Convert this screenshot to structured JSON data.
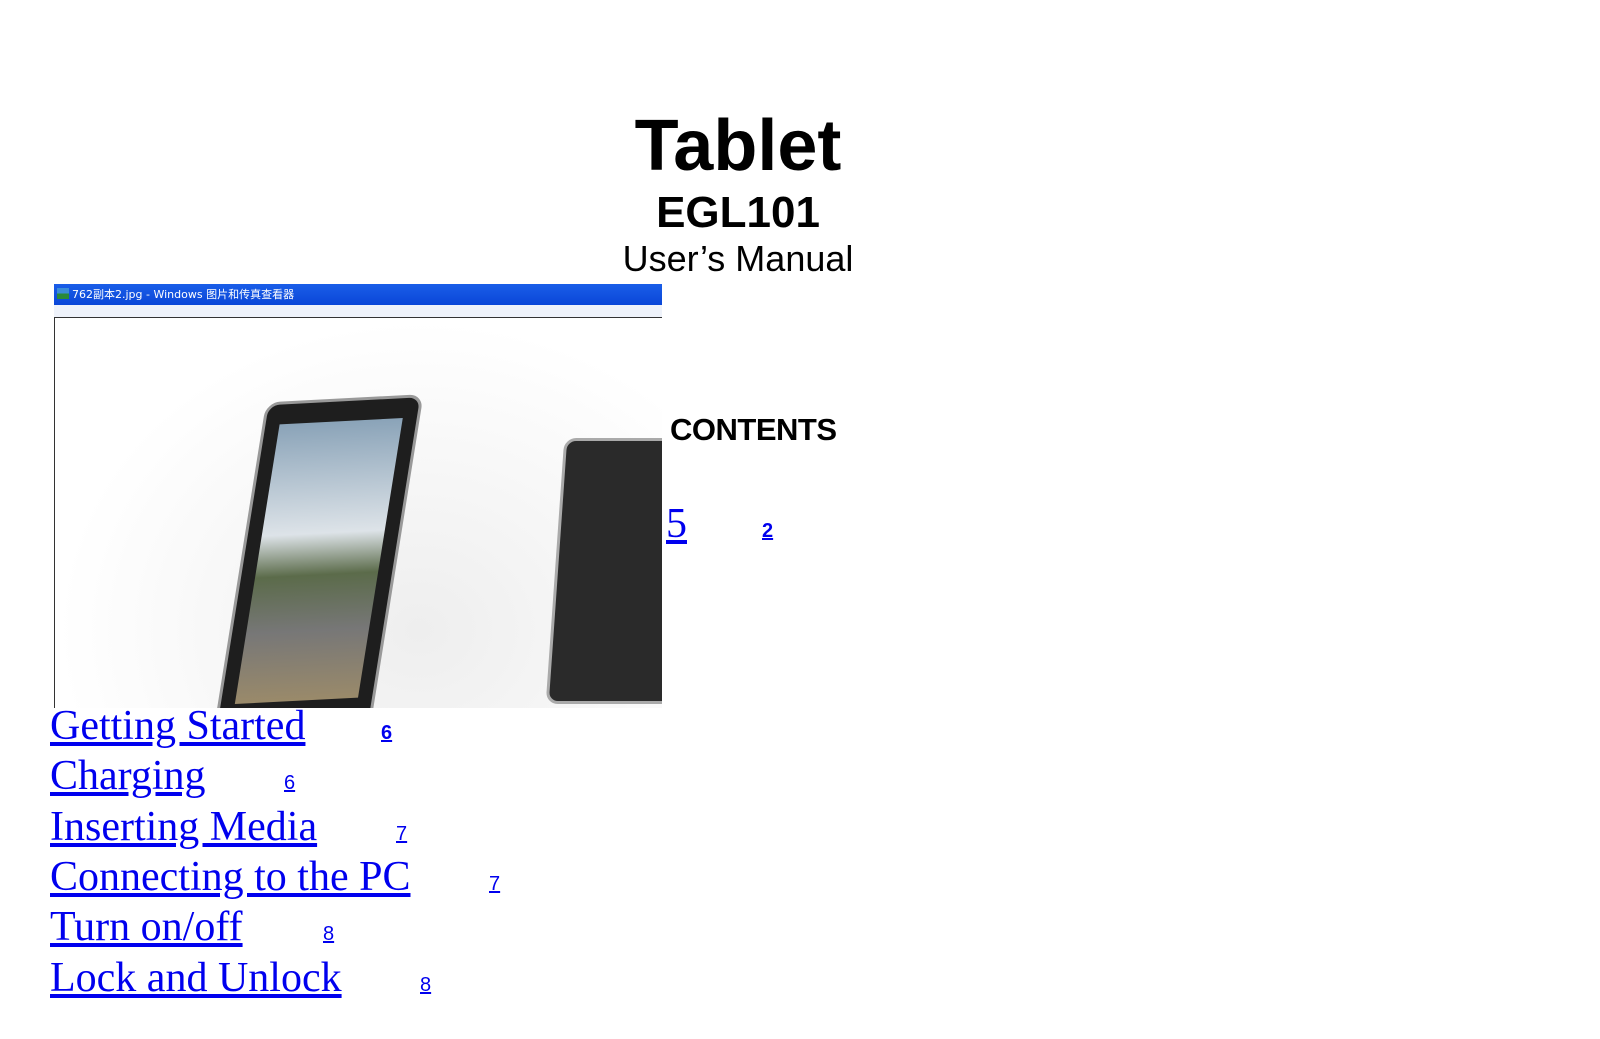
{
  "header": {
    "title": "Tablet",
    "model": "EGL101",
    "subtitle": "User’s Manual"
  },
  "contents_heading": "CONTENTS",
  "embedded_screenshot": {
    "window_title": "762副本2.jpg - Windows 图片和传真查看器"
  },
  "partial_entry": {
    "label": "5",
    "page": "2"
  },
  "toc": [
    {
      "label": "Getting Started",
      "page": "6"
    },
    {
      "label": "Charging",
      "page": "6"
    },
    {
      "label": "Inserting Media",
      "page": "7"
    },
    {
      "label": "Connecting to the PC",
      "page": "7"
    },
    {
      "label": "Turn on/off",
      "page": "8"
    },
    {
      "label": "Lock and Unlock",
      "page": "8"
    }
  ],
  "colors": {
    "link": "#0000ee",
    "titlebar": "#0a46d8"
  }
}
